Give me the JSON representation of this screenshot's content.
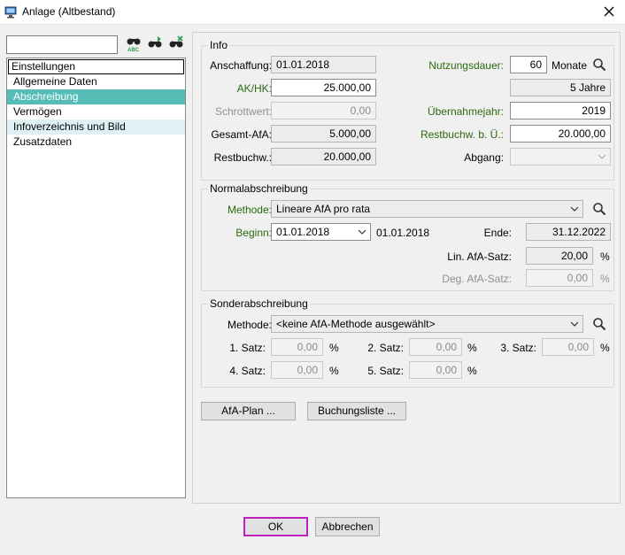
{
  "window": {
    "title": "Anlage (Altbestand)"
  },
  "search": {
    "value": ""
  },
  "tree": {
    "header": "Einstellungen",
    "items": [
      "Allgemeine Daten",
      "Abschreibung",
      "Vermögen",
      "Infoverzeichnis und Bild",
      "Zusatzdaten"
    ]
  },
  "info": {
    "title": "Info",
    "anschaffung_label": "Anschaffung:",
    "anschaffung_value": "01.01.2018",
    "akhk_label": "AK/HK:",
    "akhk_value": "25.000,00",
    "schrottwert_label": "Schrottwert:",
    "schrottwert_value": "0,00",
    "gesamt_afa_label": "Gesamt-AfA:",
    "gesamt_afa_value": "5.000,00",
    "restbuchw_label": "Restbuchw.:",
    "restbuchw_value": "20.000,00",
    "nutzungsdauer_label": "Nutzungsdauer:",
    "nutzungsdauer_value": "60",
    "nutzungsdauer_unit": "Monate",
    "jahre_value": "5 Jahre",
    "uebernahmejahr_label": "Übernahmejahr:",
    "uebernahmejahr_value": "2019",
    "restbuchw_ue_label": "Restbuchw. b. Ü.:",
    "restbuchw_ue_value": "20.000,00",
    "abgang_label": "Abgang:",
    "abgang_value": ""
  },
  "normal": {
    "title": "Normalabschreibung",
    "methode_label": "Methode:",
    "methode_value": "Lineare AfA pro rata",
    "beginn_label": "Beginn:",
    "beginn_value": "01.01.2018",
    "beginn_text": "01.01.2018",
    "ende_label": "Ende:",
    "ende_value": "31.12.2022",
    "lin_label": "Lin. AfA-Satz:",
    "lin_value": "20,00",
    "deg_label": "Deg. AfA-Satz:",
    "deg_value": "0,00",
    "percent": "%"
  },
  "sonder": {
    "title": "Sonderabschreibung",
    "methode_label": "Methode:",
    "methode_value": "<keine AfA-Methode ausgewählt>",
    "satz1_label": "1. Satz:",
    "satz1_value": "0,00",
    "satz2_label": "2. Satz:",
    "satz2_value": "0,00",
    "satz3_label": "3. Satz:",
    "satz3_value": "0,00",
    "satz4_label": "4. Satz:",
    "satz4_value": "0,00",
    "satz5_label": "5. Satz:",
    "satz5_value": "0,00",
    "percent": "%"
  },
  "buttons": {
    "afa_plan": "AfA-Plan ...",
    "buchungsliste": "Buchungsliste ...",
    "ok": "OK",
    "abbrechen": "Abbrechen"
  },
  "colors": {
    "selection": "#55bdb6",
    "hover": "#dff1f4",
    "label_green": "#2a6a0f",
    "ok_focus": "#c020c0"
  }
}
